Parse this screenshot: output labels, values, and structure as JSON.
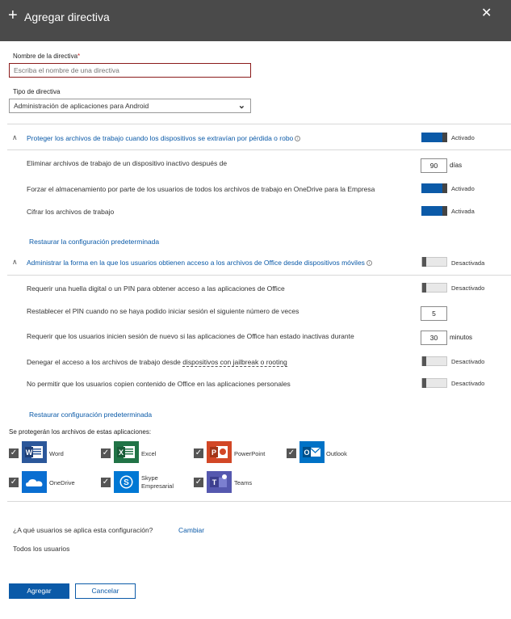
{
  "header": {
    "title": "Agregar directiva",
    "plus_glyph": "+",
    "close_glyph": "✕"
  },
  "form": {
    "name_label": "Nombre de la directiva",
    "required_mark": "*",
    "name_value": "",
    "name_placeholder": "Escriba el nombre de una directiva",
    "type_label": "Tipo de directiva",
    "type_value": "Administración de aplicaciones para Android"
  },
  "section1": {
    "title": "Proteger los archivos de trabajo cuando los dispositivos se extravían por pérdida o robo",
    "toggle_state": "Activado",
    "rows": [
      {
        "text": "Eliminar archivos de trabajo de un dispositivo inactivo después de",
        "value": "90",
        "unit": "días"
      },
      {
        "text": "Forzar el almacenamiento por parte de los usuarios de todos los archivos de trabajo en OneDrive para la Empresa",
        "state": "Activado"
      },
      {
        "text": "Cifrar los archivos de trabajo",
        "state": "Activada"
      }
    ],
    "restore_link": "Restaurar la configuración predeterminada"
  },
  "section2": {
    "title": "Administrar la forma en la que los usuarios obtienen acceso a los archivos de Office desde dispositivos móviles",
    "toggle_state": "Desactivada",
    "rows": [
      {
        "text": "Requerir una huella digital o un PIN para obtener acceso a las aplicaciones de Office",
        "state": "Desactivado"
      },
      {
        "text": "Restablecer el PIN cuando no se haya podido iniciar sesión el siguiente número de veces",
        "value": "5"
      },
      {
        "text": "Requerir que los usuarios inicien sesión de nuevo si las aplicaciones de Office han estado inactivas durante",
        "value": "30",
        "unit": "minutos"
      },
      {
        "text_before": "Denegar el acceso a los archivos de trabajo desde ",
        "text_link": "dispositivos con jailbreak o rooting",
        "state": "Desactivado"
      },
      {
        "text": "No permitir que los usuarios copien contenido de Office en las aplicaciones personales",
        "state": "Desactivado"
      }
    ],
    "restore_link": "Restaurar configuración predeterminada"
  },
  "apps": {
    "heading": "Se protegerán los archivos de estas aplicaciones:",
    "checkmark": "✓",
    "items": [
      {
        "name": "Word",
        "icon": "word-icon",
        "color": "#2b579a",
        "letter": "W"
      },
      {
        "name": "Excel",
        "icon": "excel-icon",
        "color": "#217346",
        "letter": "X"
      },
      {
        "name": "PowerPoint",
        "icon": "powerpoint-icon",
        "color": "#d24726",
        "letter": "P"
      },
      {
        "name": "Outlook",
        "icon": "outlook-icon",
        "color": "#0072c6",
        "letter": "O"
      },
      {
        "name": "OneDrive",
        "icon": "onedrive-icon",
        "color": "#0a6ed1",
        "letter": ""
      },
      {
        "name": "Skype",
        "name2": "Empresarial",
        "icon": "skype-icon",
        "color": "#0078d4",
        "letter": "S"
      },
      {
        "name": "Teams",
        "icon": "teams-icon",
        "color": "#5558af",
        "letter": "T"
      }
    ]
  },
  "users": {
    "question": "¿A qué usuarios se aplica esta configuración?",
    "change_link": "Cambiar",
    "value": "Todos los usuarios"
  },
  "footer": {
    "primary": "Agregar",
    "secondary": "Cancelar"
  },
  "colors": {
    "accent": "#0b5aa8",
    "header_bg": "#4a4a4a",
    "error_border": "#8b1b1b"
  }
}
